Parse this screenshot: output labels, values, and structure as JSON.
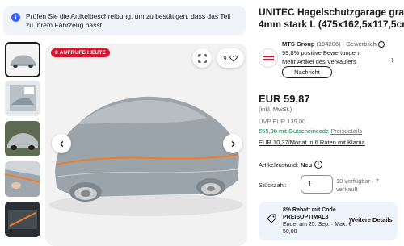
{
  "notice": {
    "text": "Prüfen Sie die Artikelbeschreibung, um zu bestätigen, dass das Teil zu Ihrem Fahrzeug passt"
  },
  "gallery": {
    "badge": "8 AUFRUFE HEUTE",
    "watch_count": "9"
  },
  "product": {
    "title_line1": "UNITEC Hagelschutzgarage grau",
    "title_line2": "4mm stark L (475x162,5x117,5cm)"
  },
  "seller": {
    "name": "MTS Group",
    "count": "(194206)",
    "type": "· Gewerblich",
    "rating": "99,8% positive Bewertungen",
    "more_items": "Mehr Artikel des Verkäufers",
    "message_button": "Nachricht"
  },
  "pricing": {
    "price": "EUR 59,87",
    "vat": "(inkl. MwSt.)",
    "uvp": "UVP EUR 139,00",
    "coupon_price": "€55,08 mit Gutscheincode",
    "price_details": "Preisdetails",
    "installment": "EUR 10,37/Monat in 6 Raten mit Klarna"
  },
  "details": {
    "condition_label": "Artikelzustand:",
    "condition_value": "Neu",
    "quantity_label": "Stückzahl:",
    "quantity_value": "1",
    "availability": "10 verfügbar · 7 verkauft"
  },
  "promo": {
    "headline": "8% Rabatt mit Code",
    "code": "PREISOPTIMAL8",
    "terms": "Endet am 25. Sep. · Max. € 50,00",
    "link": "Weitere Details"
  },
  "colors": {
    "accent_blue": "#3665f3",
    "badge_red": "#e0102d",
    "saving_green": "#05823f"
  }
}
